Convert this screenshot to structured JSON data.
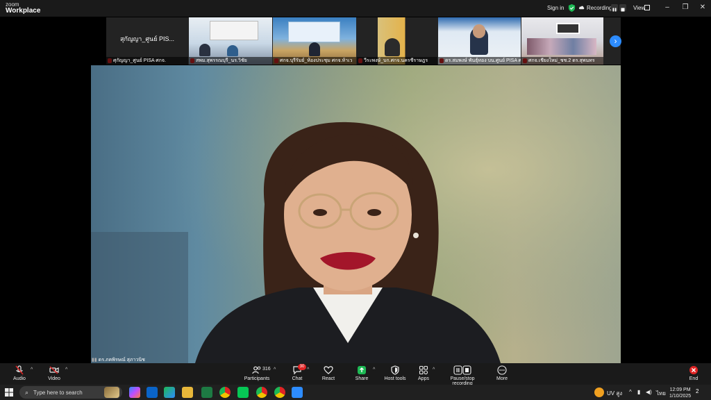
{
  "app": {
    "logo_top": "zoom",
    "logo_bottom": "Workplace"
  },
  "titlebar": {
    "sign_in": "Sign in",
    "recording_label": "Recording...",
    "view_label": "View",
    "minimize": "–",
    "restore": "❐",
    "close": "✕"
  },
  "thumbnails": [
    {
      "name": "ศุกัญญา_ศูนย์ PISA ศกจ.",
      "center_text": "สุกัญญา_ศูนย์ PIS..."
    },
    {
      "name": "สพม.สุพรรณบุรี_นร.วิชัย"
    },
    {
      "name": "ศกจ.บุรีรัมย์_ห้องประชุม ศกจ.ห้าเว"
    },
    {
      "name": "วีระพงษ์_บก.ศกจ.นครชีราษฎร"
    },
    {
      "name": "ดร.สมพงษ์ พันธุ์ทอง บน.ศูนย์ PISA ศก..."
    },
    {
      "name": "ศกจ.เชียงใหม่_ชช.2 ดร.สุพนทร"
    }
  ],
  "main_video": {
    "participant_name": "ดร.ภคพิรษณ์ สุภาวนิช"
  },
  "toolbar": {
    "audio": "Audio",
    "video": "Video",
    "participants": "Participants",
    "participants_count": "316",
    "chat": "Chat",
    "chat_badge": "30",
    "react": "React",
    "share": "Share",
    "host_tools": "Host tools",
    "apps": "Apps",
    "recording": "Pause/stop recording",
    "more": "More",
    "end": "End"
  },
  "taskbar": {
    "search_placeholder": "Type here to search",
    "tray_weather": "UV สูง",
    "tray_lang": "ไทย",
    "time": "12:09 PM",
    "date": "1/10/2025",
    "notifications": "2"
  },
  "colors": {
    "accent": "#2d8cff",
    "share_green": "#1db954",
    "end_red": "#e02424",
    "mic_red": "#e02424"
  }
}
